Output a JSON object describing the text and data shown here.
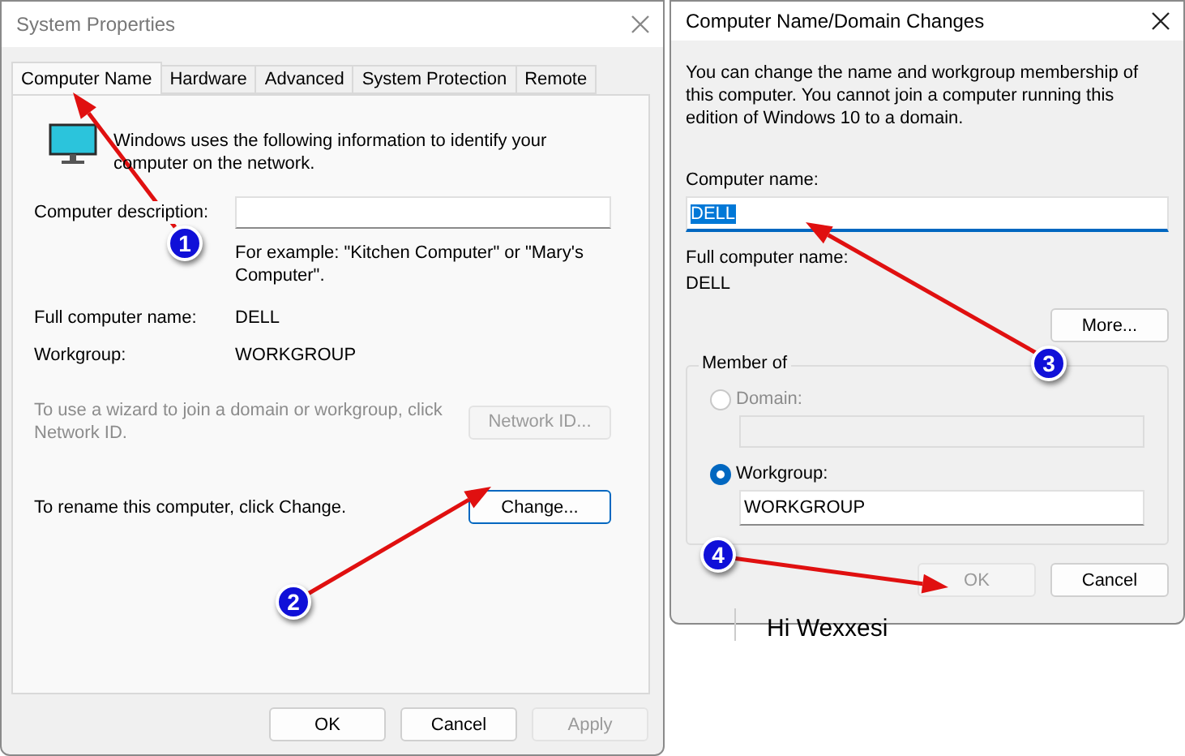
{
  "system_properties": {
    "title": "System Properties",
    "tabs": [
      {
        "label": "Computer Name",
        "selected": true
      },
      {
        "label": "Hardware",
        "selected": false
      },
      {
        "label": "Advanced",
        "selected": false
      },
      {
        "label": "System Protection",
        "selected": false
      },
      {
        "label": "Remote",
        "selected": false
      }
    ],
    "intro": "Windows uses the following information to identify your computer on the network.",
    "description_label": "Computer description:",
    "example": "For example: \"Kitchen Computer\" or \"Mary's Computer\".",
    "rows": [
      {
        "label": "Full computer name:",
        "value": "DELL"
      },
      {
        "label": "Workgroup:",
        "value": "WORKGROUP"
      }
    ],
    "network": {
      "text": "To use a wizard to join a domain or workgroup, click Network ID.",
      "button": "Network ID...",
      "disabled": true
    },
    "rename": {
      "text": "To rename this computer, click Change.",
      "button": "Change...",
      "focused": true
    },
    "buttons": [
      {
        "label": "OK",
        "disabled": false
      },
      {
        "label": "Cancel",
        "disabled": false
      },
      {
        "label": "Apply",
        "disabled": true
      }
    ]
  },
  "change_dialog": {
    "title": "Computer Name/Domain Changes",
    "description": "You can change the name and workgroup membership of this computer. You cannot join a computer running this edition of Windows 10 to a domain.",
    "name_label": "Computer name:",
    "name_value": "DELL",
    "name_selected": true,
    "full_label": "Full computer name:",
    "full_value": "DELL",
    "more_button": "More...",
    "member_of": {
      "title": "Member of",
      "options": [
        {
          "label": "Domain:",
          "selected": false,
          "disabled": true
        },
        {
          "label": "Workgroup:",
          "selected": true,
          "disabled": false,
          "value": "WORKGROUP"
        }
      ]
    },
    "buttons": [
      {
        "label": "OK",
        "disabled": true
      },
      {
        "label": "Cancel",
        "disabled": false
      }
    ]
  },
  "background_text": "Hi Wexxesi",
  "annotations": [
    {
      "number": "1"
    },
    {
      "number": "2"
    },
    {
      "number": "3"
    },
    {
      "number": "4"
    }
  ]
}
